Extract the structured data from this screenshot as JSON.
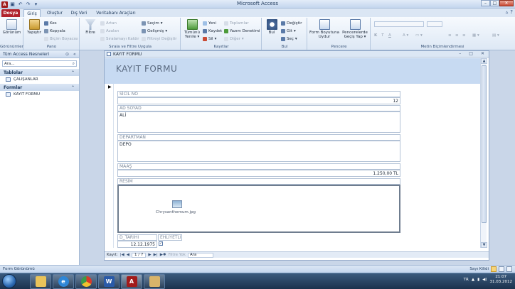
{
  "window": {
    "title": "Microsoft Access"
  },
  "qat": {
    "app_letter": "A",
    "undo": "↶",
    "redo": "↷",
    "save": "▣",
    "customize": "▾"
  },
  "window_buttons": {
    "minimize": "–",
    "maximize": "□",
    "close": "✕"
  },
  "tabs": [
    "Dosya",
    "Giriş",
    "Oluştur",
    "Dış Veri",
    "Veritabanı Araçları"
  ],
  "help_icons": {
    "collapse": "▵",
    "help": "?"
  },
  "ribbon": {
    "groups": [
      {
        "label": "Görünümler",
        "buttons": [
          "Görünüm"
        ]
      },
      {
        "label": "Pano",
        "buttons": [
          "Yapıştır",
          "Kes",
          "Kopyala",
          "Biçim Boyacısı"
        ]
      },
      {
        "label": "Sırala ve Filtre Uygula",
        "buttons": [
          "Filtre",
          "Artan",
          "Azalan",
          "Sıralamayı Kaldır",
          "Seçim",
          "Gelişmiş",
          "Filtreyi Değiştir"
        ]
      },
      {
        "label": "Kayıtlar",
        "buttons": [
          "Tümünü Yenile",
          "Yeni",
          "Kaydet",
          "Sil",
          "Toplamlar",
          "Yazım Denetimi",
          "Diğer"
        ]
      },
      {
        "label": "Bul",
        "buttons": [
          "Bul",
          "Değiştir",
          "Git",
          "Seç"
        ]
      },
      {
        "label": "Pencere",
        "buttons": [
          "Form Boyutuna Uydur",
          "Pencerelerde Geçiş Yap"
        ]
      },
      {
        "label": "Metin Biçimlendirmesi",
        "buttons": []
      }
    ]
  },
  "nav": {
    "title": "Tüm Access Nesneleri",
    "search_placeholder": "Ara...",
    "sections": [
      {
        "name": "Tablolar",
        "items": [
          "ÇALIŞANLAR"
        ]
      },
      {
        "name": "Formlar",
        "items": [
          "KAYIT FORMU"
        ]
      }
    ]
  },
  "form": {
    "tab_title": "KAYIT FORMU",
    "header_title": "KAYIT FORMU",
    "fields": {
      "sicil_label": "SİCİL NO",
      "sicil_value": "12",
      "adsoyad_label": "AD SOYAD",
      "adsoyad_value": "ALİ",
      "departman_label": "DEPARTMAN",
      "departman_value": "DEPO",
      "maas_label": "MAAŞ",
      "maas_value": "1.250,00 TL",
      "resim_label": "RESİM",
      "resim_file": "Chrysanthemum.jpg",
      "dtarihi_label": "D_TARIHI",
      "dtarihi_value": "12.12.1975",
      "ehliyet_label": "EHLIYETLI",
      "ehliyet_checked": "✓"
    }
  },
  "record_nav": {
    "label": "Kayıt:",
    "position": "1 / 7",
    "filter": "Filtre Yok",
    "search": "Ara"
  },
  "statusbar": {
    "left": "Form Görünümü",
    "num_lock": "Sayı Kilidi"
  },
  "taskbar": {
    "lang": "TR",
    "time": "21:07",
    "date": "31.03.2012"
  }
}
